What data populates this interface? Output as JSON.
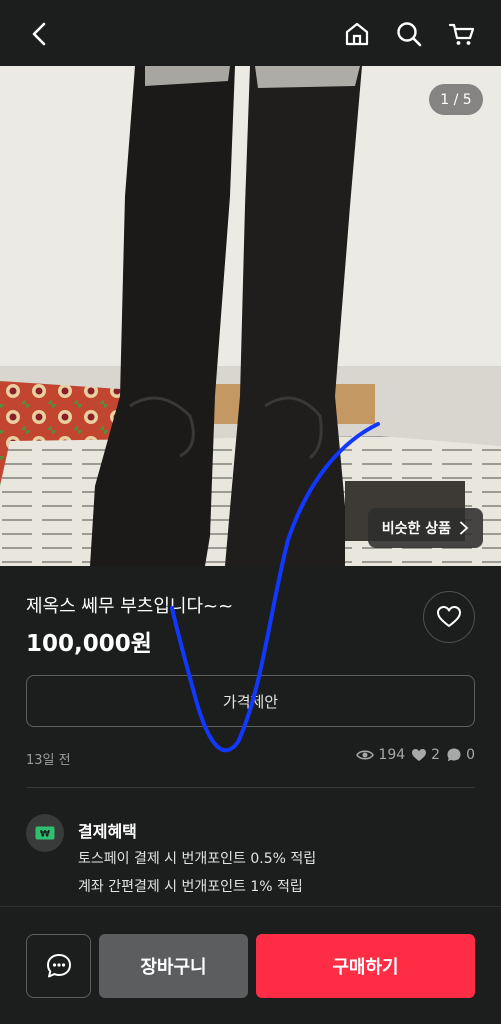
{
  "header": {
    "icons": [
      "back-arrow-icon",
      "home-icon",
      "search-icon",
      "cart-icon"
    ]
  },
  "gallery": {
    "counter": "1 / 5",
    "similar_label": "비슷한 상품"
  },
  "product": {
    "title": "제옥스  쎄무  부츠입니다~~",
    "price": "100,000원",
    "offer_label": "가격제안",
    "time_ago": "13일 전",
    "stats": {
      "views": "194",
      "likes": "2",
      "chats": "0"
    }
  },
  "benefits": {
    "title": "결제혜택",
    "lines": [
      "토스페이 결제 시 번개포인트 0.5% 적립",
      "계좌 간편결제 시 번개포인트 1% 적립"
    ],
    "icon": "won-card-icon",
    "icon_color": "#2fbf71"
  },
  "bottom": {
    "cart_label": "장바구니",
    "buy_label": "구매하기",
    "buy_color": "#ff2c46"
  },
  "colors": {
    "background": "#1c1e1d",
    "annotation_stroke": "#1238ff"
  }
}
